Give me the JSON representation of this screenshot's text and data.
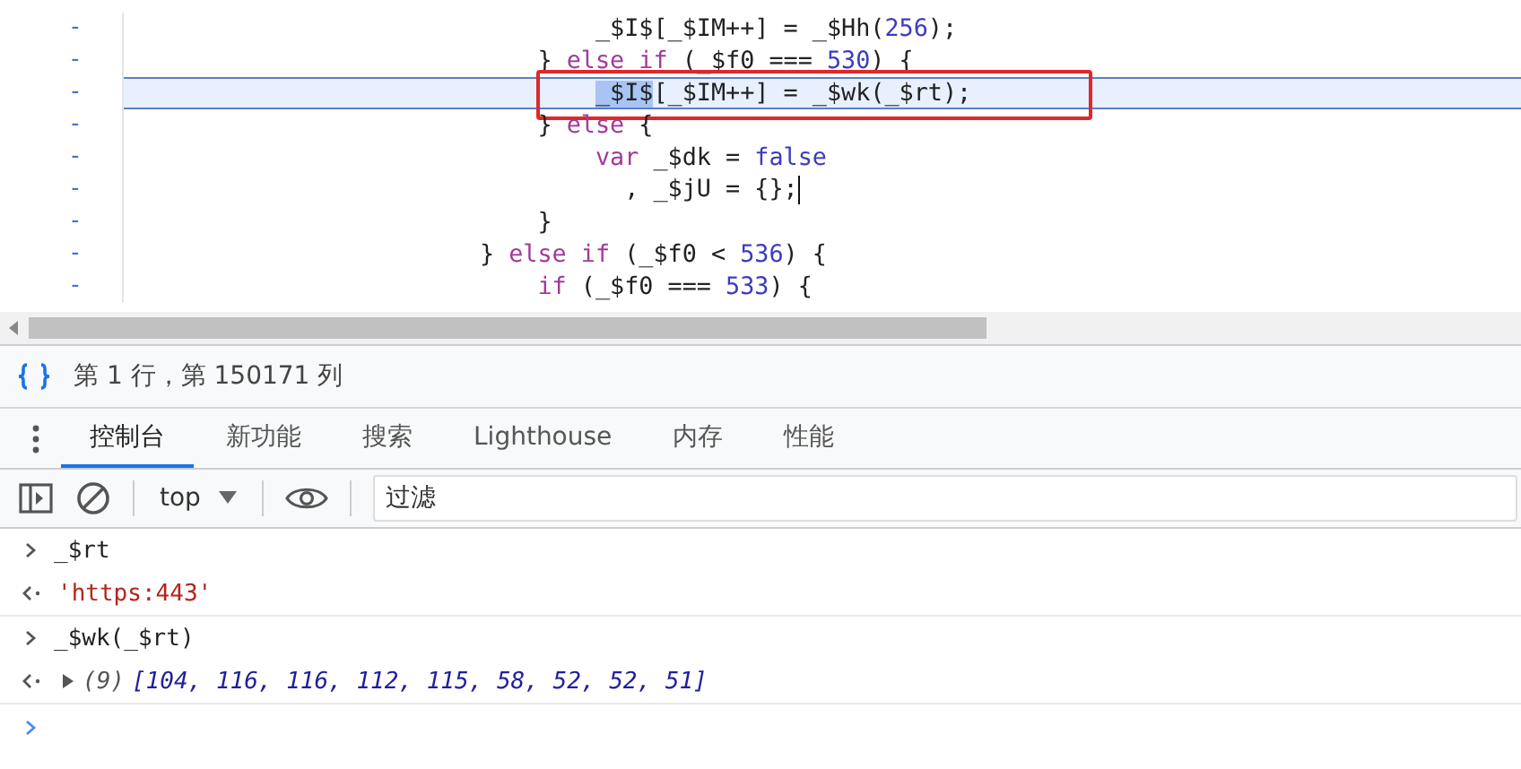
{
  "editor": {
    "lines": [
      {
        "gutter": "-",
        "highlighted": false,
        "annotated": false,
        "cursor": false,
        "segments": [
          {
            "kind": "plain",
            "text": "                                _$I$[_$IM++] = _$Hh("
          },
          {
            "kind": "number",
            "text": "256"
          },
          {
            "kind": "plain",
            "text": ");"
          }
        ]
      },
      {
        "gutter": "-",
        "highlighted": false,
        "annotated": false,
        "cursor": false,
        "segments": [
          {
            "kind": "plain",
            "text": "                            } "
          },
          {
            "kind": "keyword",
            "text": "else if"
          },
          {
            "kind": "plain",
            "text": " (_$f0 === "
          },
          {
            "kind": "number",
            "text": "530"
          },
          {
            "kind": "plain",
            "text": ") {"
          }
        ]
      },
      {
        "gutter": "-",
        "highlighted": true,
        "annotated": true,
        "cursor": false,
        "segments": [
          {
            "kind": "selected",
            "text": "                                _$I$"
          },
          {
            "kind": "plain",
            "text": "[_$IM++] = _$wk(_$rt);"
          }
        ]
      },
      {
        "gutter": "-",
        "highlighted": false,
        "annotated": false,
        "cursor": false,
        "segments": [
          {
            "kind": "plain",
            "text": "                            } "
          },
          {
            "kind": "keyword",
            "text": "else"
          },
          {
            "kind": "plain",
            "text": " {"
          }
        ]
      },
      {
        "gutter": "-",
        "highlighted": false,
        "annotated": false,
        "cursor": false,
        "segments": [
          {
            "kind": "keyword",
            "text": "                                var"
          },
          {
            "kind": "plain",
            "text": " _$dk = "
          },
          {
            "kind": "number",
            "text": "false"
          }
        ]
      },
      {
        "gutter": "-",
        "highlighted": false,
        "annotated": false,
        "cursor": true,
        "segments": [
          {
            "kind": "plain",
            "text": "                                  , _$jU = {};"
          }
        ]
      },
      {
        "gutter": "-",
        "highlighted": false,
        "annotated": false,
        "cursor": false,
        "segments": [
          {
            "kind": "plain",
            "text": "                            }"
          }
        ]
      },
      {
        "gutter": "-",
        "highlighted": false,
        "annotated": false,
        "cursor": false,
        "segments": [
          {
            "kind": "plain",
            "text": "                        } "
          },
          {
            "kind": "keyword",
            "text": "else if"
          },
          {
            "kind": "plain",
            "text": " (_$f0 < "
          },
          {
            "kind": "number",
            "text": "536"
          },
          {
            "kind": "plain",
            "text": ") {"
          }
        ]
      },
      {
        "gutter": "-",
        "highlighted": false,
        "annotated": false,
        "cursor": false,
        "segments": [
          {
            "kind": "keyword",
            "text": "                            if"
          },
          {
            "kind": "plain",
            "text": " (_$f0 === "
          },
          {
            "kind": "number",
            "text": "533"
          },
          {
            "kind": "plain",
            "text": ") {"
          }
        ]
      }
    ]
  },
  "status_bar": {
    "position": "第 1 行，第 150171 列"
  },
  "drawer_tabs": [
    {
      "label": "控制台",
      "selected": true
    },
    {
      "label": "新功能",
      "selected": false
    },
    {
      "label": "搜索",
      "selected": false
    },
    {
      "label": "Lighthouse",
      "selected": false
    },
    {
      "label": "内存",
      "selected": false
    },
    {
      "label": "性能",
      "selected": false
    }
  ],
  "console_toolbar": {
    "context": "top",
    "filter": {
      "placeholder": "过滤"
    }
  },
  "console": [
    {
      "kind": "input",
      "text": "_$rt"
    },
    {
      "kind": "string",
      "text": "'https:443'"
    },
    {
      "kind": "input",
      "text": "_$wk(_$rt)"
    },
    {
      "kind": "array",
      "count": "(9)",
      "text": "[104, 116, 116, 112, 115, 58, 52, 52, 51]"
    }
  ]
}
